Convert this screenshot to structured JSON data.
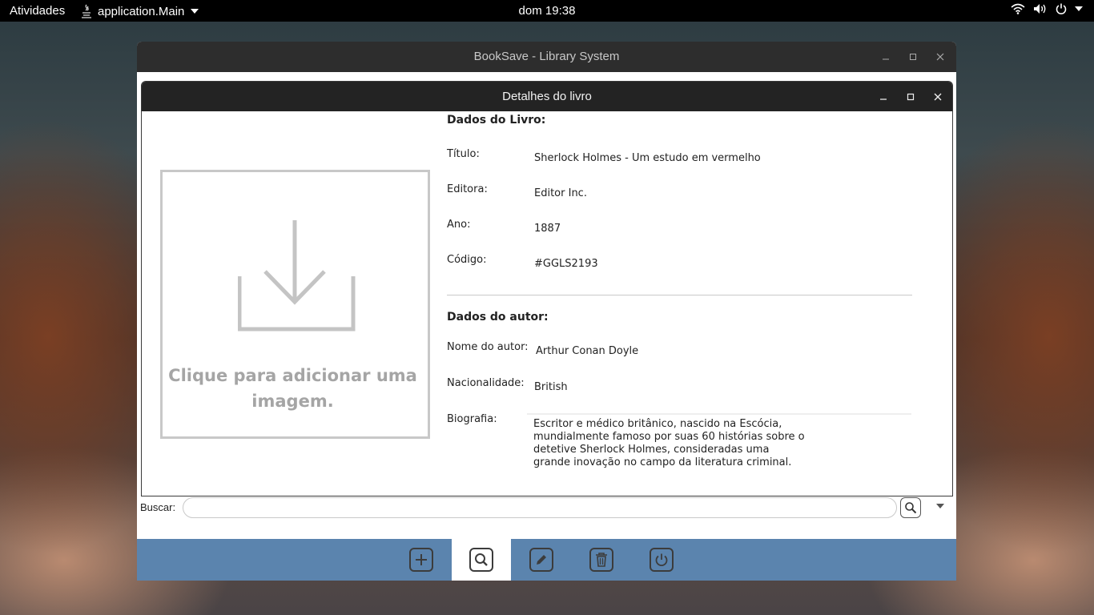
{
  "topbar": {
    "activities": "Atividades",
    "app_name": "application.Main",
    "clock": "dom 19:38"
  },
  "main_window": {
    "title": "BookSave - Library System",
    "search_label": "Buscar:",
    "search_value": "",
    "toolbar": [
      {
        "name": "add-icon",
        "active": false
      },
      {
        "name": "search-icon",
        "active": true
      },
      {
        "name": "edit-icon",
        "active": false
      },
      {
        "name": "trash-icon",
        "active": false
      },
      {
        "name": "power-icon",
        "active": false
      }
    ]
  },
  "dialog": {
    "title": "Detalhes do livro",
    "image_placeholder": "Clique para adicionar uma imagem.",
    "book_section": "Dados do Livro:",
    "title_label": "Título:",
    "title_value": "Sherlock Holmes - Um estudo em vermelho",
    "publisher_label": "Editora:",
    "publisher_value": "Editor Inc.",
    "year_label": "Ano:",
    "year_value": "1887",
    "code_label": "Código:",
    "code_value": "#GGLS2193",
    "author_section": "Dados do autor:",
    "author_name_label": "Nome do autor:",
    "author_name_value": "Arthur Conan Doyle",
    "nationality_label": "Nacionalidade:",
    "nationality_value": "British",
    "bio_label": "Biografia:",
    "bio_value": "Escritor e médico britânico, nascido na Escócia, mundialmente famoso por suas 60 histórias sobre o detetive Sherlock Holmes, consideradas uma grande inovação no campo da literatura criminal."
  }
}
